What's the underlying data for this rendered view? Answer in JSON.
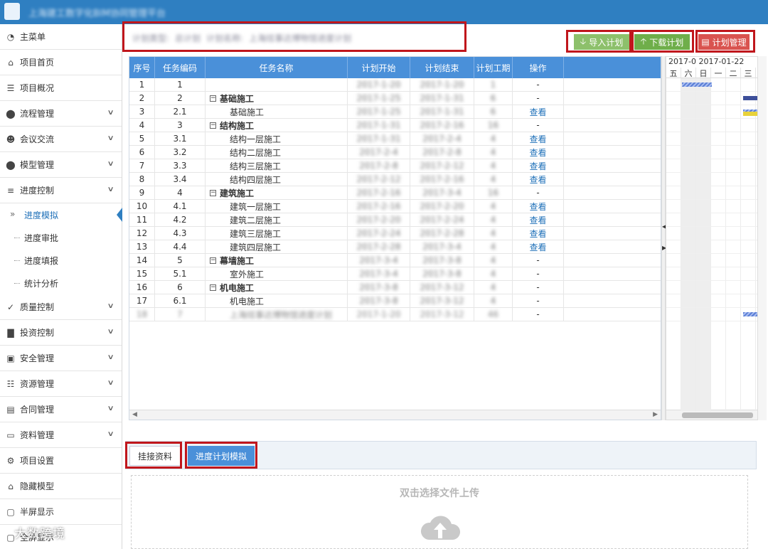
{
  "header": {
    "title": "上海建工数字化BIM协同管理平台"
  },
  "sidebar": {
    "items": [
      {
        "label": "主菜单",
        "icon": "dashboard-icon",
        "chevron": false
      },
      {
        "label": "项目首页",
        "icon": "home-icon",
        "chevron": false
      },
      {
        "label": "项目概况",
        "icon": "document-icon",
        "chevron": false
      },
      {
        "label": "流程管理",
        "icon": "database-icon",
        "chevron": true
      },
      {
        "label": "会议交流",
        "icon": "users-icon",
        "chevron": true
      },
      {
        "label": "模型管理",
        "icon": "database-icon",
        "chevron": true
      },
      {
        "label": "进度控制",
        "icon": "sliders-icon",
        "chevron": true
      }
    ],
    "sub_items": [
      {
        "label": "进度模拟",
        "active": true
      },
      {
        "label": "进度审批",
        "active": false
      },
      {
        "label": "进度填报",
        "active": false
      },
      {
        "label": "统计分析",
        "active": false
      }
    ],
    "items_after": [
      {
        "label": "质量控制",
        "icon": "check-circle-icon",
        "chevron": true
      },
      {
        "label": "投资控制",
        "icon": "bar-chart-icon",
        "chevron": true
      },
      {
        "label": "安全管理",
        "icon": "lock-icon",
        "chevron": true
      },
      {
        "label": "资源管理",
        "icon": "layers-icon",
        "chevron": true
      },
      {
        "label": "合同管理",
        "icon": "contract-icon",
        "chevron": true
      },
      {
        "label": "资料管理",
        "icon": "monitor-icon",
        "chevron": true
      },
      {
        "label": "项目设置",
        "icon": "settings-icon",
        "chevron": false
      },
      {
        "label": "隐藏模型",
        "icon": "home-icon",
        "chevron": false
      },
      {
        "label": "半屏显示",
        "icon": "window-icon",
        "chevron": false
      },
      {
        "label": "全屏显示",
        "icon": "window-icon",
        "chevron": false
      }
    ]
  },
  "filter": {
    "type_label": "计划类型:",
    "type_value": "总计划",
    "name_label": "计划名称:",
    "name_value": "上海炫事达博物馆进度计划"
  },
  "toolbar": {
    "import_label": "导入计划",
    "download_label": "下载计划",
    "manage_label": "计划管理"
  },
  "table": {
    "headers": [
      "序号",
      "任务编码",
      "任务名称",
      "计划开始",
      "计划结束",
      "计划工期",
      "操作"
    ],
    "rows": [
      {
        "seq": "1",
        "code": "1",
        "name": "",
        "group": false,
        "start": "2017-1-20",
        "end": "2017-1-20",
        "dur": "1",
        "op": "-"
      },
      {
        "seq": "2",
        "code": "2",
        "name": "基础施工",
        "group": true,
        "start": "2017-1-25",
        "end": "2017-1-31",
        "dur": "6",
        "op": "-"
      },
      {
        "seq": "3",
        "code": "2.1",
        "name": "基础施工",
        "group": false,
        "start": "2017-1-25",
        "end": "2017-1-31",
        "dur": "6",
        "op": "查看"
      },
      {
        "seq": "4",
        "code": "3",
        "name": "结构施工",
        "group": true,
        "start": "2017-1-31",
        "end": "2017-2-16",
        "dur": "16",
        "op": "-"
      },
      {
        "seq": "5",
        "code": "3.1",
        "name": "结构一层施工",
        "group": false,
        "start": "2017-1-31",
        "end": "2017-2-4",
        "dur": "4",
        "op": "查看"
      },
      {
        "seq": "6",
        "code": "3.2",
        "name": "结构二层施工",
        "group": false,
        "start": "2017-2-4",
        "end": "2017-2-8",
        "dur": "4",
        "op": "查看"
      },
      {
        "seq": "7",
        "code": "3.3",
        "name": "结构三层施工",
        "group": false,
        "start": "2017-2-8",
        "end": "2017-2-12",
        "dur": "4",
        "op": "查看"
      },
      {
        "seq": "8",
        "code": "3.4",
        "name": "结构四层施工",
        "group": false,
        "start": "2017-2-12",
        "end": "2017-2-16",
        "dur": "4",
        "op": "查看"
      },
      {
        "seq": "9",
        "code": "4",
        "name": "建筑施工",
        "group": true,
        "start": "2017-2-16",
        "end": "2017-3-4",
        "dur": "16",
        "op": "-"
      },
      {
        "seq": "10",
        "code": "4.1",
        "name": "建筑一层施工",
        "group": false,
        "start": "2017-2-16",
        "end": "2017-2-20",
        "dur": "4",
        "op": "查看"
      },
      {
        "seq": "11",
        "code": "4.2",
        "name": "建筑二层施工",
        "group": false,
        "start": "2017-2-20",
        "end": "2017-2-24",
        "dur": "4",
        "op": "查看"
      },
      {
        "seq": "12",
        "code": "4.3",
        "name": "建筑三层施工",
        "group": false,
        "start": "2017-2-24",
        "end": "2017-2-28",
        "dur": "4",
        "op": "查看"
      },
      {
        "seq": "13",
        "code": "4.4",
        "name": "建筑四层施工",
        "group": false,
        "start": "2017-2-28",
        "end": "2017-3-4",
        "dur": "4",
        "op": "查看"
      },
      {
        "seq": "14",
        "code": "5",
        "name": "幕墙施工",
        "group": true,
        "start": "2017-3-4",
        "end": "2017-3-8",
        "dur": "4",
        "op": "-"
      },
      {
        "seq": "15",
        "code": "5.1",
        "name": "室外施工",
        "group": false,
        "start": "2017-3-4",
        "end": "2017-3-8",
        "dur": "4",
        "op": "-"
      },
      {
        "seq": "16",
        "code": "6",
        "name": "机电施工",
        "group": true,
        "start": "2017-3-8",
        "end": "2017-3-12",
        "dur": "4",
        "op": "-"
      },
      {
        "seq": "17",
        "code": "6.1",
        "name": "机电施工",
        "group": false,
        "start": "2017-3-8",
        "end": "2017-3-12",
        "dur": "4",
        "op": "-"
      },
      {
        "seq": "18",
        "code": "7",
        "name": "上海炫事达博物馆进度计划",
        "group": false,
        "start": "2017-1-20",
        "end": "2017-3-12",
        "dur": "46",
        "op": "-",
        "blurred": true
      }
    ]
  },
  "gantt": {
    "date_header": "2017-0 2017-01-22",
    "days": [
      "五",
      "六",
      "日",
      "一",
      "二",
      "三"
    ]
  },
  "tabs": {
    "attach_label": "挂接资料",
    "sim_label": "进度计划模拟"
  },
  "upload": {
    "prompt": "双击选择文件上传"
  },
  "watermark": {
    "text": "大数跨境"
  },
  "colors": {
    "topbar": "#2f7fc1",
    "header_blue": "#4a90d9",
    "green_light": "#8dc06b",
    "green": "#6fae4a",
    "red": "#d9534f",
    "highlight_red": "#c0161c",
    "link": "#1d6fb8"
  }
}
